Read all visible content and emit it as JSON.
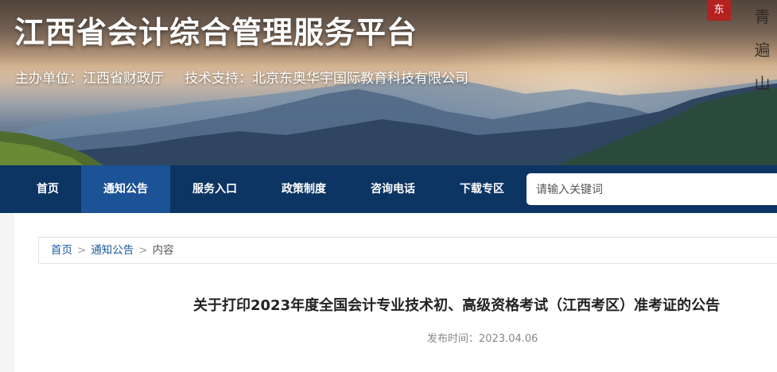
{
  "header": {
    "site_title": "江西省会计综合管理服务平台",
    "sponsor": "主办单位：江西省财政厅",
    "tech_support": "技术支持：北京东奥华宇国际教育科技有限公司",
    "seal_text": "东",
    "calligraphy_text": "青遍山"
  },
  "nav": {
    "items": [
      {
        "label": "首页"
      },
      {
        "label": "通知公告"
      },
      {
        "label": "服务入口"
      },
      {
        "label": "政策制度"
      },
      {
        "label": "咨询电话"
      },
      {
        "label": "下载专区"
      }
    ],
    "active_index": 1,
    "search_placeholder": "请输入关键词"
  },
  "breadcrumb": {
    "home": "首页",
    "section": "通知公告",
    "current": "内容",
    "separator": ">"
  },
  "article": {
    "title": "关于打印2023年度全国会计专业技术初、高级资格考试（江西考区）准考证的公告",
    "publish_label": "发布时间：",
    "publish_date": "2023.04.06"
  },
  "colors": {
    "nav_bg": "#0c3563",
    "nav_active": "#1c5296",
    "link": "#1a5a9c"
  }
}
